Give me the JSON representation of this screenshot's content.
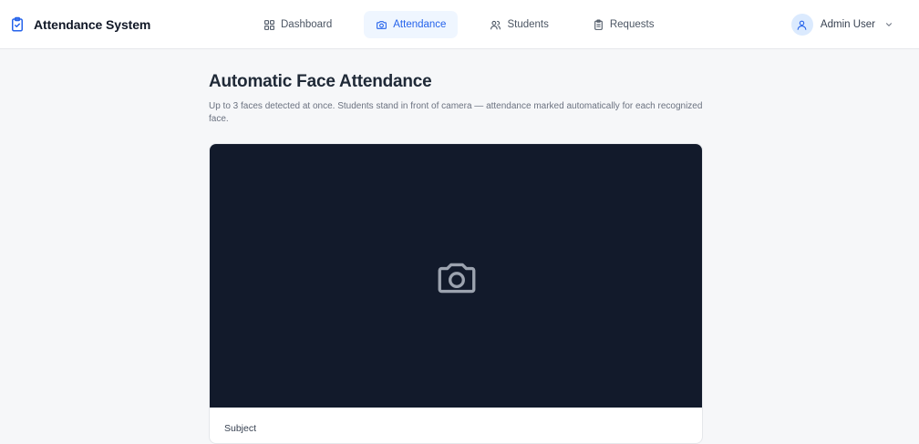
{
  "app": {
    "title": "Attendance System",
    "brand_icon": "clipboard-check-icon",
    "accent_color": "#2563eb"
  },
  "nav": {
    "items": [
      {
        "label": "Dashboard",
        "icon": "grid-icon",
        "active": false
      },
      {
        "label": "Attendance",
        "icon": "camera-icon",
        "active": true
      },
      {
        "label": "Students",
        "icon": "users-icon",
        "active": false
      },
      {
        "label": "Requests",
        "icon": "clipboard-icon",
        "active": false
      }
    ]
  },
  "user": {
    "name": "Admin User",
    "icon": "user-icon",
    "menu_icon": "chevron-down-icon"
  },
  "page": {
    "title": "Automatic Face Attendance",
    "description": "Up to 3 faces detected at once. Students stand in front of camera — attendance marked automatically for each recognized face."
  },
  "camera": {
    "placeholder_icon": "camera-icon",
    "background_color": "#121a2b"
  },
  "form": {
    "subject_label": "Subject"
  }
}
